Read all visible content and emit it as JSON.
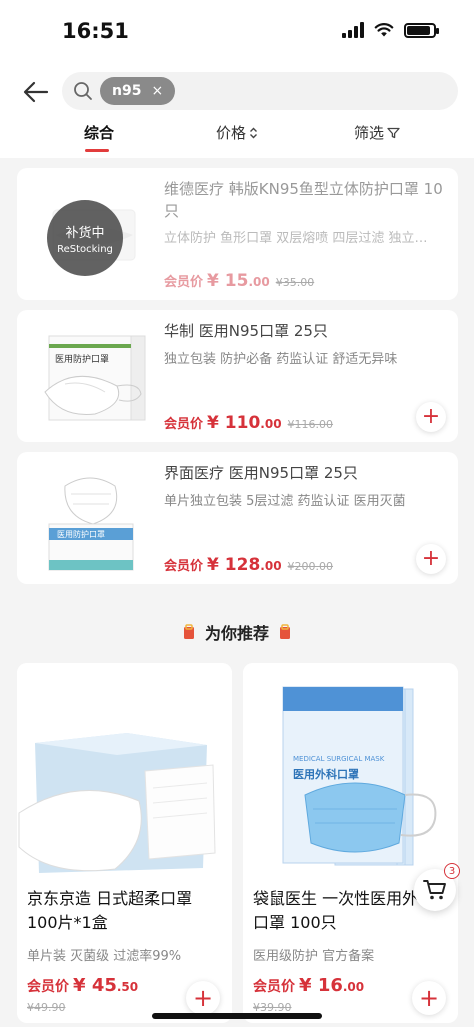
{
  "status_bar": {
    "time": "16:51"
  },
  "search": {
    "query_chip": "n95",
    "clear_icon": "×"
  },
  "tabs": [
    {
      "label": "综合",
      "active": true
    },
    {
      "label": "价格",
      "icon": "sort-icon"
    },
    {
      "label": "筛选",
      "icon": "filter-icon"
    }
  ],
  "products": [
    {
      "title": "维德医疗 韩版KN95鱼型立体防护口罩 10只",
      "tags": "立体防护 鱼形口罩 双层熔喷 四层过滤 独立…",
      "price_label": "会员价",
      "currency": "¥",
      "price_int": "15",
      "price_dec": ".00",
      "original_price": "¥35.00",
      "restock_cn": "补货中",
      "restock_en": "ReStocking"
    },
    {
      "title": "华制 医用N95口罩 25只",
      "tags": "独立包装 防护必备  药监认证 舒适无异味",
      "price_label": "会员价",
      "currency": "¥",
      "price_int": "110",
      "price_dec": ".00",
      "original_price": "¥116.00",
      "box_text": "医用防护口罩"
    },
    {
      "title": "界面医疗 医用N95口罩 25只",
      "tags": "单片独立包装 5层过滤  药监认证 医用灭菌",
      "price_label": "会员价",
      "currency": "¥",
      "price_int": "128",
      "price_dec": ".00",
      "original_price": "¥200.00",
      "box_text": "医用防护口罩"
    }
  ],
  "recommend": {
    "heading": "为你推荐",
    "items": [
      {
        "title": "京东京造 日式超柔口罩 100片*1盒",
        "tags": "单片装 灭菌级 过滤率99%",
        "price_label": "会员价",
        "currency": "¥",
        "price_int": "45",
        "price_dec": ".50",
        "original_price": "¥49.90"
      },
      {
        "title": "袋鼠医生 一次性医用外科口罩 100只",
        "tags": "医用级防护  官方备案",
        "price_label": "会员价",
        "currency": "¥",
        "price_int": "16",
        "price_dec": ".00",
        "original_price": "¥39.90",
        "pack_text": "医用外科口罩",
        "pack_text_en": "MEDICAL SURGICAL MASK"
      }
    ]
  },
  "cart": {
    "count": "3"
  },
  "colors": {
    "accent": "#d6323a",
    "background": "#f4f4f4"
  }
}
